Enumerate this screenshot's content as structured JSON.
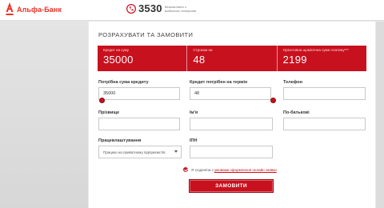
{
  "header": {
    "logo_text": "Альфа-Банк",
    "phone_number": "3530",
    "phone_note": "безкоштовно з мобільних телефонів"
  },
  "form": {
    "title": "РОЗРАХУВАТИ ТА ЗАМОВИТИ",
    "summary": [
      {
        "label": "Кредит на суму",
        "value": "35000"
      },
      {
        "label": "Строком на",
        "value": "48"
      },
      {
        "label": "Орієнтовна щомісячна сума платежу***",
        "value": "2199"
      }
    ],
    "amount": {
      "label": "Потрібна сума кредиту",
      "value": "35000",
      "slider_fraction": 0.0
    },
    "term": {
      "label": "Кредит потрібен на термін",
      "value": "48",
      "slider_fraction": 1.0
    },
    "phone": {
      "label": "Телефон",
      "value": ""
    },
    "surname": {
      "label": "Прізвище",
      "value": ""
    },
    "name": {
      "label": "Ім'я",
      "value": ""
    },
    "patronymic": {
      "label": "По-батькові",
      "value": ""
    },
    "employment": {
      "label": "Працевлаштування",
      "selected": "Працюю на приватному підприємстві"
    },
    "tax_id": {
      "label": "ІПН",
      "value": ""
    },
    "consent": {
      "prefix": "Я згоден/на з ",
      "link": "умовами оформлення онлайн заявки"
    },
    "submit_label": "ЗАМОВИТИ"
  },
  "colors": {
    "accent": "#c8111e",
    "brand": "#ef3124"
  }
}
